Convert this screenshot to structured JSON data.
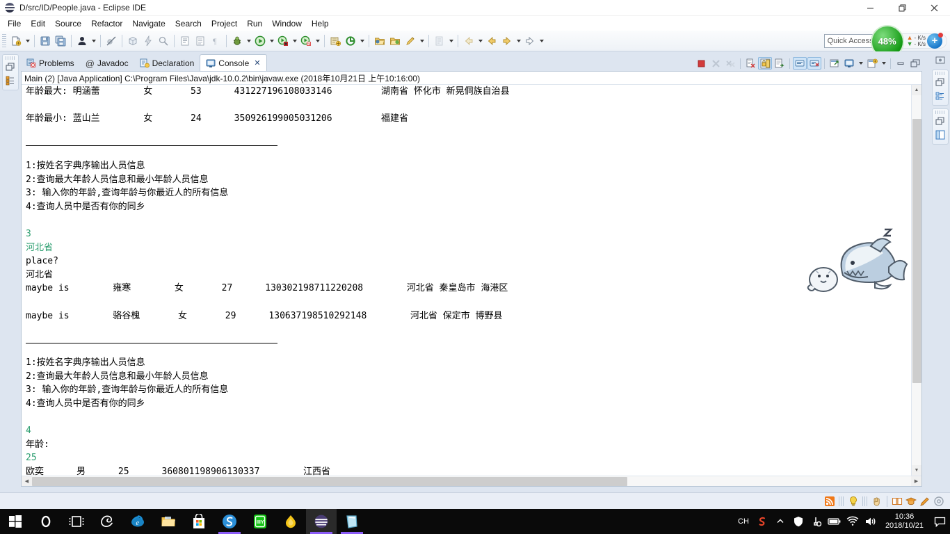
{
  "window": {
    "title": "D/src/ID/People.java - Eclipse IDE",
    "app_icon": "eclipse-sphere-icon",
    "minimize_label": "Minimize",
    "restore_label": "Restore",
    "close_label": "Close"
  },
  "menubar": {
    "items": [
      {
        "label": "File"
      },
      {
        "label": "Edit"
      },
      {
        "label": "Source"
      },
      {
        "label": "Refactor"
      },
      {
        "label": "Navigate"
      },
      {
        "label": "Search"
      },
      {
        "label": "Project"
      },
      {
        "label": "Run"
      },
      {
        "label": "Window"
      },
      {
        "label": "Help"
      }
    ]
  },
  "toolbar": {
    "buttons": [
      {
        "name": "new-wizard",
        "icon": "new-file-icon",
        "dropdown": true
      },
      {
        "name": "save",
        "icon": "save-icon",
        "dropdown": false
      },
      {
        "name": "save-all",
        "icon": "save-all-icon",
        "dropdown": false
      },
      {
        "name": "toggle-breadcrumb",
        "icon": "person-icon",
        "dropdown": true
      },
      {
        "name": "skip-breakpoints",
        "icon": "skip-breakpoints-icon",
        "dropdown": false
      },
      {
        "name": "new-java-package",
        "icon": "package-icon",
        "dropdown": false
      },
      {
        "name": "build-all",
        "icon": "lightning-icon",
        "dropdown": false
      },
      {
        "name": "search",
        "icon": "search-icon",
        "dropdown": false
      },
      {
        "name": "open-task",
        "icon": "task-icon",
        "dropdown": false
      },
      {
        "name": "open-type",
        "icon": "open-type-icon",
        "dropdown": false
      },
      {
        "name": "pilcrow",
        "icon": "pilcrow-icon",
        "dropdown": false
      },
      {
        "name": "debug",
        "icon": "debug-bug-icon",
        "dropdown": true
      },
      {
        "name": "run",
        "icon": "run-play-icon",
        "dropdown": true
      },
      {
        "name": "coverage",
        "icon": "coverage-icon",
        "dropdown": true
      },
      {
        "name": "profile",
        "icon": "profile-icon",
        "dropdown": true
      },
      {
        "name": "new-java-project",
        "icon": "java-project-icon",
        "dropdown": false
      },
      {
        "name": "external-tools",
        "icon": "external-tools-icon",
        "dropdown": true
      },
      {
        "name": "open-resource",
        "icon": "open-folder-icon",
        "dropdown": false
      },
      {
        "name": "open-folder",
        "icon": "folder-icon",
        "dropdown": false
      },
      {
        "name": "edit-pencil",
        "icon": "pencil-icon",
        "dropdown": true
      },
      {
        "name": "annotation",
        "icon": "annotation-icon",
        "dropdown": true
      },
      {
        "name": "previous-edit",
        "icon": "back-arrow-icon",
        "dropdown": false
      },
      {
        "name": "back",
        "icon": "back-yellow-arrow-icon",
        "dropdown": false
      },
      {
        "name": "forward",
        "icon": "forward-arrow-icon",
        "dropdown": true
      },
      {
        "name": "forward-next",
        "icon": "forward-white-arrow-icon",
        "dropdown": true
      }
    ],
    "quick_access_placeholder": "Quick Access",
    "cpu_percent": "48%",
    "upload_speed": "- K/s",
    "download_speed": "- K/s",
    "plus_badge": "+"
  },
  "view_tabs": [
    {
      "label": "Problems",
      "icon": "problems-icon",
      "active": false,
      "closable": false
    },
    {
      "label": "Javadoc",
      "icon": "javadoc-at-icon",
      "active": false,
      "closable": false
    },
    {
      "label": "Declaration",
      "icon": "declaration-icon",
      "active": false,
      "closable": false
    },
    {
      "label": "Console",
      "icon": "console-icon",
      "active": true,
      "closable": true,
      "close_glyph": "✕"
    }
  ],
  "console_toolbar": [
    {
      "name": "terminate",
      "icon": "terminate-red-square-icon",
      "state": "enabled"
    },
    {
      "name": "remove-launch",
      "icon": "remove-x-icon",
      "state": "disabled"
    },
    {
      "name": "remove-all-terminated",
      "icon": "remove-all-xx-icon",
      "state": "disabled"
    },
    {
      "name": "clear-console",
      "icon": "clear-console-icon",
      "state": "enabled"
    },
    {
      "name": "scroll-lock",
      "icon": "scroll-lock-icon",
      "state": "toggled"
    },
    {
      "name": "word-wrap",
      "icon": "word-wrap-icon",
      "state": "enabled"
    },
    {
      "name": "show-console-on-output",
      "icon": "show-on-output-icon",
      "state": "toggled"
    },
    {
      "name": "show-console-on-error",
      "icon": "show-on-error-icon",
      "state": "toggled"
    },
    {
      "name": "pin-console",
      "icon": "pin-console-icon",
      "state": "enabled"
    },
    {
      "name": "display-selected-console",
      "icon": "display-console-icon",
      "state": "enabled",
      "dropdown": true
    },
    {
      "name": "open-console",
      "icon": "open-console-icon",
      "state": "enabled",
      "dropdown": true
    },
    {
      "name": "minimize-view",
      "icon": "minimize-icon",
      "state": "enabled"
    },
    {
      "name": "maximize-view",
      "icon": "maximize-icon",
      "state": "enabled"
    }
  ],
  "console": {
    "launch_header": "Main (2) [Java Application] C:\\Program Files\\Java\\jdk-10.0.2\\bin\\javaw.exe (2018年10月21日 上午10:16:00)",
    "lines": [
      {
        "text": "年龄最大: 明涵蕾        女       53      431227196108033146         湖南省 怀化市 新晃侗族自治县",
        "style": "normal"
      },
      {
        "text": "",
        "style": "normal"
      },
      {
        "text": "年龄最小: 蓝山兰        女       24      350926199005031206         福建省",
        "style": "normal"
      },
      {
        "text": "",
        "style": "normal"
      },
      {
        "text": "",
        "style": "rule"
      },
      {
        "text": "1:按姓名字典序输出人员信息",
        "style": "normal"
      },
      {
        "text": "2:查询最大年龄人员信息和最小年龄人员信息",
        "style": "normal"
      },
      {
        "text": "3: 输入你的年龄,查询年龄与你最近人的所有信息",
        "style": "normal"
      },
      {
        "text": "4:查询人员中是否有你的同乡",
        "style": "normal"
      },
      {
        "text": "",
        "style": "normal"
      },
      {
        "text": "3",
        "style": "green"
      },
      {
        "text": "河北省",
        "style": "green"
      },
      {
        "text": "place?",
        "style": "normal"
      },
      {
        "text": "河北省",
        "style": "normal"
      },
      {
        "text": "maybe is        雍寒        女       27      130302198711220208        河北省 秦皇岛市 海港区",
        "style": "normal"
      },
      {
        "text": "",
        "style": "normal"
      },
      {
        "text": "maybe is        骆谷槐       女       29      130637198510292148        河北省 保定市 博野县",
        "style": "normal"
      },
      {
        "text": "",
        "style": "normal"
      },
      {
        "text": "",
        "style": "rule"
      },
      {
        "text": "1:按姓名字典序输出人员信息",
        "style": "normal"
      },
      {
        "text": "2:查询最大年龄人员信息和最小年龄人员信息",
        "style": "normal"
      },
      {
        "text": "3: 输入你的年龄,查询年龄与你最近人的所有信息",
        "style": "normal"
      },
      {
        "text": "4:查询人员中是否有你的同乡",
        "style": "normal"
      },
      {
        "text": "",
        "style": "normal"
      },
      {
        "text": "4",
        "style": "green"
      },
      {
        "text": "年龄:",
        "style": "normal"
      },
      {
        "text": "25",
        "style": "green"
      },
      {
        "text": "欧奕      男      25      360801198906130337        江西省",
        "style": "normal"
      }
    ],
    "decoration_icon": "shark-and-seal-sticker"
  },
  "fast_views": {
    "left": [
      {
        "name": "restore-icon"
      },
      {
        "name": "package-explorer-icon"
      }
    ],
    "right": [
      {
        "name": "outline-top-icon"
      },
      {
        "name": "restore-icon"
      },
      {
        "name": "outline-tree-icon"
      },
      {
        "name": "restore-icon"
      },
      {
        "name": "task-list-icon"
      }
    ]
  },
  "statusbar": {
    "icons": [
      {
        "name": "rss-feed-icon"
      },
      {
        "name": "lightbulb-icon"
      },
      {
        "name": "hand-pointer-icon"
      },
      {
        "name": "dictionary-book-icon"
      },
      {
        "name": "graduation-cap-icon"
      },
      {
        "name": "pencil-marker-icon"
      },
      {
        "name": "settings-gear-icon"
      }
    ]
  },
  "taskbar": {
    "items": [
      {
        "name": "start-button",
        "icon": "windows-logo-icon",
        "running": false,
        "active": false
      },
      {
        "name": "cortana-search",
        "icon": "cortana-circle-icon",
        "running": false,
        "active": false
      },
      {
        "name": "task-view",
        "icon": "task-view-icon",
        "running": false,
        "active": false
      },
      {
        "name": "edge-legacy",
        "icon": "edge-outline-icon",
        "running": false,
        "active": false
      },
      {
        "name": "internet-explorer",
        "icon": "internet-explorer-icon",
        "running": false,
        "active": false
      },
      {
        "name": "file-explorer",
        "icon": "file-explorer-icon",
        "running": false,
        "active": false
      },
      {
        "name": "microsoft-store",
        "icon": "microsoft-store-icon",
        "running": false,
        "active": false
      },
      {
        "name": "sogou-browser",
        "icon": "sogou-icon",
        "running": true,
        "active": false
      },
      {
        "name": "diy-app",
        "icon": "diy-green-icon",
        "running": false,
        "active": false
      },
      {
        "name": "yellow-drop-app",
        "icon": "yellow-drop-icon",
        "running": false,
        "active": false
      },
      {
        "name": "eclipse-ide",
        "icon": "eclipse-sphere-icon",
        "running": true,
        "active": true
      },
      {
        "name": "notes-app",
        "icon": "notes-book-icon",
        "running": true,
        "active": false
      }
    ],
    "ime_label": "CH",
    "tray": [
      {
        "name": "sogou-tray-icon"
      },
      {
        "name": "hidden-icons-chevron"
      },
      {
        "name": "security-shield-icon"
      },
      {
        "name": "usb-device-icon"
      },
      {
        "name": "battery-icon"
      },
      {
        "name": "network-wifi-icon"
      },
      {
        "name": "volume-icon"
      }
    ],
    "clock_time": "10:36",
    "clock_date": "2018/10/21",
    "action_center": "notification-icon"
  }
}
